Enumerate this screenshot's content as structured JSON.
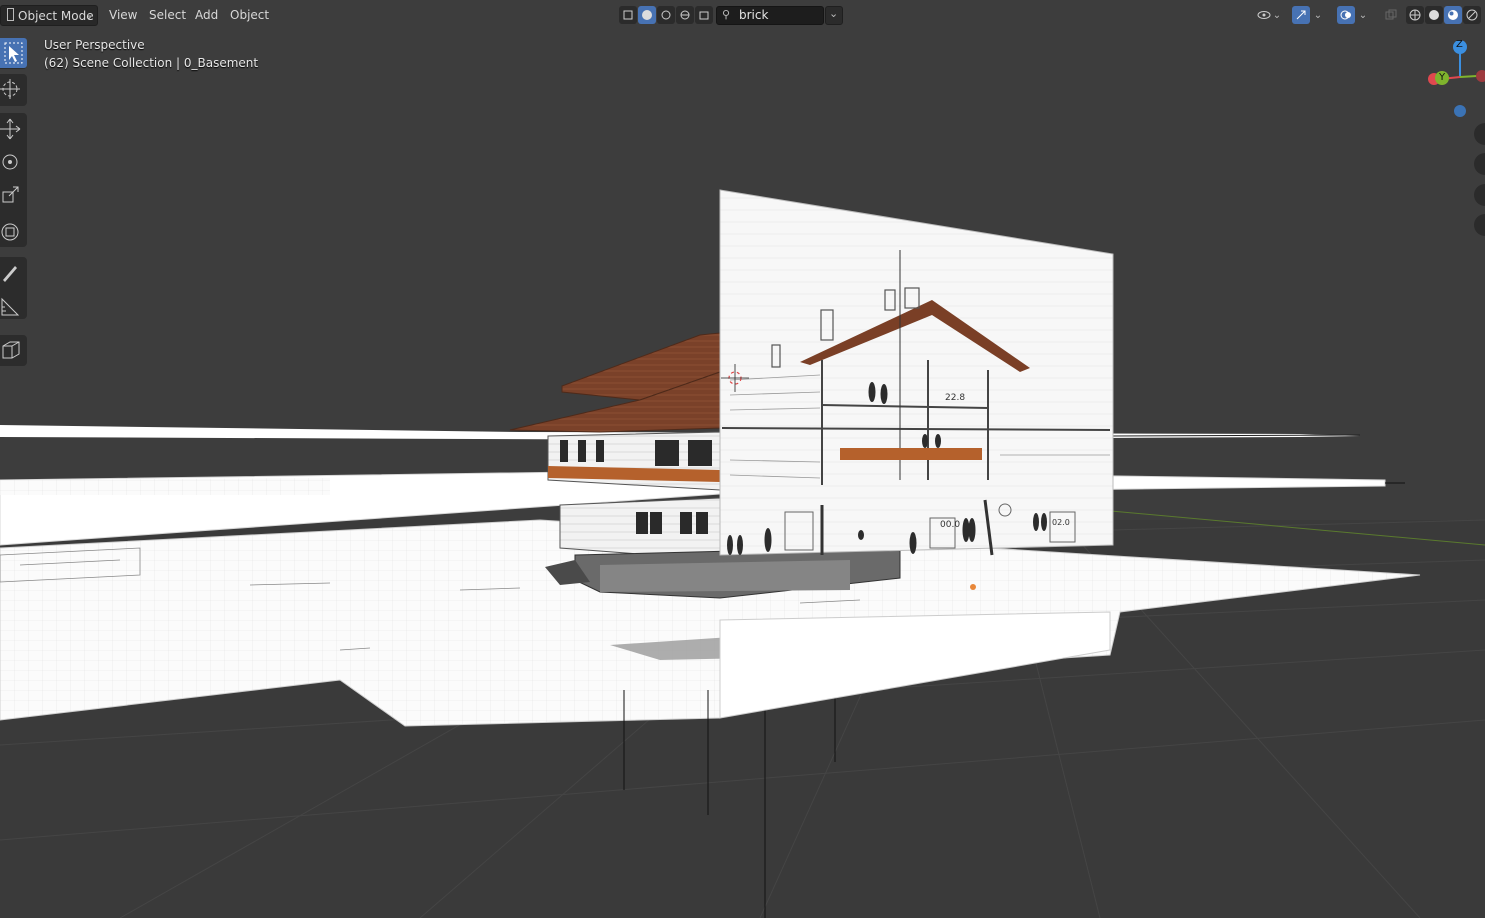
{
  "header": {
    "mode_label": "Object Mode",
    "menus": [
      "View",
      "Select",
      "Add",
      "Object"
    ],
    "search_value": "brick"
  },
  "overlay": {
    "perspective": "User Perspective",
    "collection": "(62) Scene Collection | 0_Basement"
  },
  "gizmo": {
    "z_label": "Z",
    "y_label": "Y"
  },
  "annotations": {
    "height_a": "22.8",
    "height_b": "00.0",
    "height_c": "02.0"
  },
  "colors": {
    "viewport_bg": "#3d3d3d",
    "active_blue": "#4772b3",
    "roof_brown": "#7a3f26",
    "axis_x": "#e0484f",
    "axis_y": "#7fb32d",
    "axis_z": "#3b8fe0"
  },
  "tools": [
    "select-box-icon",
    "cursor-icon",
    "move-icon",
    "rotate-icon",
    "scale-icon",
    "transform-icon",
    "annotate-icon",
    "measure-icon",
    "add-cube-icon"
  ]
}
